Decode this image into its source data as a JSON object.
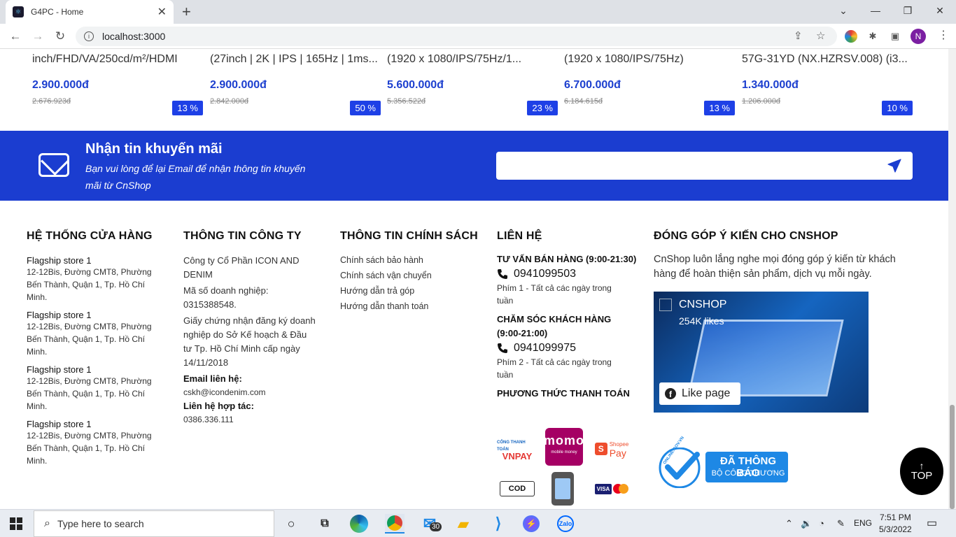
{
  "browser": {
    "tab_title": "G4PC - Home",
    "url": "localhost:3000",
    "profile_initial": "N"
  },
  "products": [
    {
      "name": "inch/FHD/VA/250cd/m²/HDMI",
      "price": "2.900.000đ",
      "old_price": "2.676.923đ",
      "discount": "13 %"
    },
    {
      "name": "(27inch | 2K | IPS | 165Hz | 1ms...",
      "price": "2.900.000đ",
      "old_price": "2.842.000đ",
      "discount": "50 %"
    },
    {
      "name": "(1920 x 1080/IPS/75Hz/1...",
      "price": "5.600.000đ",
      "old_price": "5.356.522đ",
      "discount": "23 %"
    },
    {
      "name": "(1920 x 1080/IPS/75Hz)",
      "price": "6.700.000đ",
      "old_price": "6.184.615đ",
      "discount": "13 %"
    },
    {
      "name": "57G-31YD (NX.HZRSV.008) (i3...",
      "price": "1.340.000đ",
      "old_price": "1.206.000đ",
      "discount": "10 %"
    }
  ],
  "newsletter": {
    "title": "Nhận tin khuyến mãi",
    "subtitle": "Bạn vui lòng để lại Email để nhận thông tin khuyến mãi từ CnShop",
    "email_placeholder": ""
  },
  "stores": {
    "heading": "HỆ THỐNG CỬA HÀNG",
    "items": [
      {
        "name": "Flagship store 1",
        "address": "12-12Bis, Đường CMT8, Phường Bến Thành, Quận 1, Tp. Hồ Chí Minh."
      },
      {
        "name": "Flagship store 1",
        "address": "12-12Bis, Đường CMT8, Phường Bến Thành, Quận 1, Tp. Hồ Chí Minh."
      },
      {
        "name": "Flagship store 1",
        "address": "12-12Bis, Đường CMT8, Phường Bến Thành, Quận 1, Tp. Hồ Chí Minh."
      },
      {
        "name": "Flagship store 1",
        "address": "12-12Bis, Đường CMT8, Phường Bến Thành, Quận 1, Tp. Hồ Chí Minh."
      }
    ]
  },
  "company": {
    "heading": "THÔNG TIN CÔNG TY",
    "name": "Công ty Cổ Phần ICON AND DENIM",
    "tax_code": "Mã số doanh nghiệp: 0315388548.",
    "license": "Giấy chứng nhận đăng ký doanh nghiệp do Sở Kế hoạch & Đầu tư Tp. Hồ Chí Minh cấp ngày 14/11/2018",
    "email_label": "Email liên hệ:",
    "email": "cskh@icondenim.com",
    "partner_label": "Liên hệ hợp tác:",
    "partner_phone": "0386.336.111"
  },
  "policy": {
    "heading": "THÔNG TIN CHÍNH SÁCH",
    "links": [
      "Chính sách bảo hành",
      "Chính sách vận chuyển",
      "Hướng dẫn trả góp",
      "Hướng dẫn thanh toán"
    ]
  },
  "contact": {
    "heading": "LIÊN HỆ",
    "sales_label": "TƯ VẤN BÁN HÀNG (9:00-21:30)",
    "sales_phone": "0941099503",
    "sales_note": "Phím 1 - Tất cả các ngày trong tuần",
    "care_label": "CHĂM SÓC KHÁCH HÀNG (9:00-21:00)",
    "care_phone": "0941099975",
    "care_note": "Phím 2 - Tất cả các ngày trong tuần",
    "payment_label": "PHƯƠNG THỨC THANH TOÁN",
    "payments": [
      "VNPAY",
      "momo",
      "ShopeePay",
      "COD",
      "Banking",
      "VISA"
    ],
    "vnpay_caption": "CỔNG THANH TOÁN",
    "momo_caption": "mobile money",
    "shopee_caption": "Shopee",
    "shopee_pay": "Pay"
  },
  "feedback": {
    "heading": "ĐÓNG GÓP Ý KIẾN CHO CNSHOP",
    "text": "CnShop luôn lắng nghe mọi đóng góp ý kiến từ khách hàng để hoàn thiện sản phẩm, dịch vụ mỗi ngày.",
    "fb_name": "CNSHOP",
    "fb_likes": "254K likes",
    "like_button": "Like page"
  },
  "badge": {
    "line1": "ĐÃ THÔNG BÁO",
    "line2": "BỘ CÔNG THƯƠNG",
    "seal": "ONLINE.GOV.VN"
  },
  "top_button": "TOP",
  "taskbar": {
    "search_placeholder": "Type here to search",
    "mail_count": "30",
    "zalo": "Zalo",
    "lang": "ENG",
    "time": "7:51 PM",
    "date": "5/3/2022"
  }
}
